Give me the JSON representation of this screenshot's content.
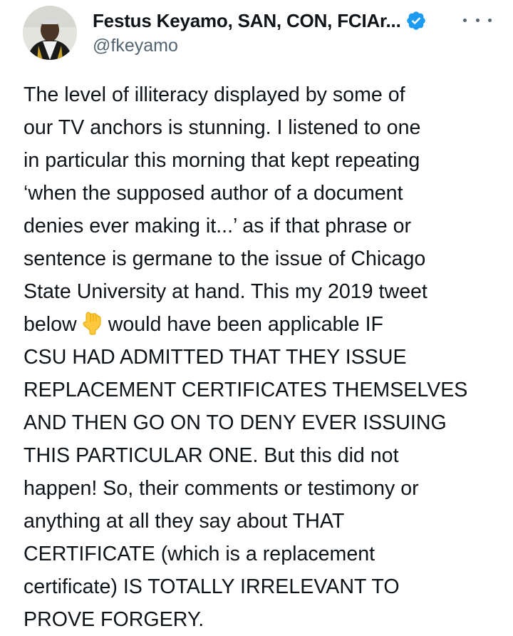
{
  "author": {
    "display_name": "Festus Keyamo, SAN, CON, FCIAr...",
    "handle": "@fkeyamo",
    "verified": true,
    "avatar_icon": "profile-photo-icon",
    "verified_icon": "verified-badge-icon"
  },
  "menu": {
    "icon": "more-options-icon"
  },
  "tweet": {
    "lines": [
      "The level of illiteracy displayed by some of",
      "our TV anchors is stunning. I listened to one",
      "in particular this morning that kept repeating",
      "‘when the supposed author of a document",
      "denies ever making it...’ as if that phrase or",
      "sentence is germane to the issue of Chicago",
      "State University at hand. This my 2019 tweet",
      "below",
      "would have been applicable IF",
      "CSU HAD ADMITTED THAT THEY ISSUE",
      "REPLACEMENT CERTIFICATES THEMSELVES",
      "AND THEN GO ON TO DENY EVER ISSUING",
      "THIS PARTICULAR ONE. But this did not",
      "happen! So, their comments or testimony or",
      "anything at all they say about THAT",
      "CERTIFICATE (which is a replacement",
      "certificate) IS TOTALLY IRRELEVANT TO",
      "PROVE FORGERY."
    ],
    "inline_emoji": "backhand-index-pointing-down-icon"
  },
  "colors": {
    "text": "#0f1419",
    "secondary": "#536471",
    "verified_blue": "#1d9bf0",
    "emoji_yellow": "#ffc83d"
  }
}
